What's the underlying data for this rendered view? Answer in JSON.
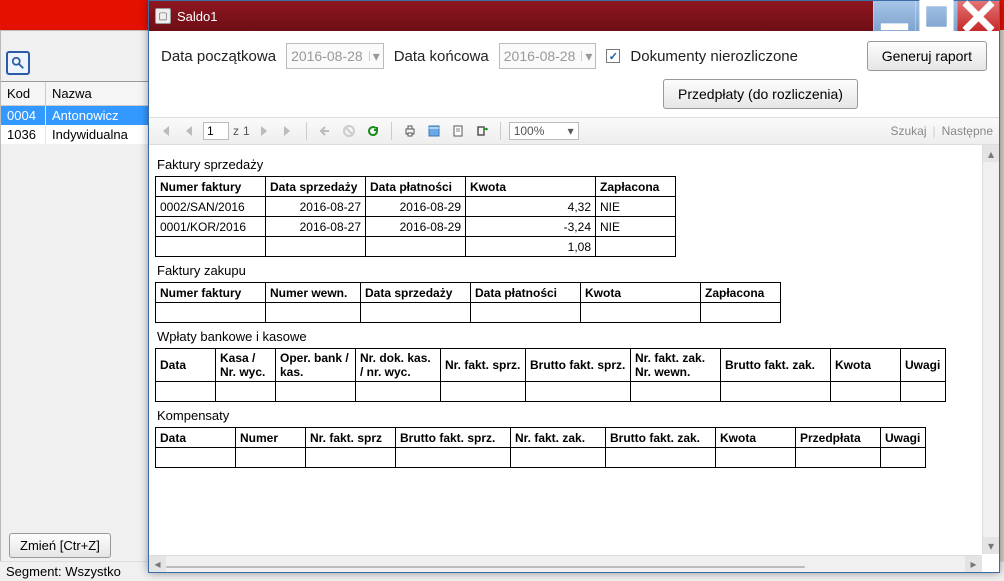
{
  "window": {
    "title": "Saldo1"
  },
  "params": {
    "start_label": "Data początkowa",
    "end_label": "Data końcowa",
    "start_value": "2016-08-28",
    "end_value": "2016-08-28",
    "unreconciled_label": "Dokumenty nierozliczone",
    "unreconciled_checked": "✓",
    "btn_report": "Generuj raport",
    "btn_prepay": "Przedpłaty (do rozliczenia)"
  },
  "viewer": {
    "page_current": "1",
    "page_of_prefix": "z",
    "page_total": "1",
    "zoom": "100%",
    "find_label": "Szukaj",
    "next_label": "Następne"
  },
  "left": {
    "col_kod": "Kod",
    "col_nazwa": "Nazwa",
    "rows": [
      {
        "kod": "0004",
        "nazwa": "Antonowicz"
      },
      {
        "kod": "1036",
        "nazwa": "Indywidualna"
      }
    ],
    "btn_change": "Zmień [Ctr+Z]",
    "status": "Segment: Wszystko"
  },
  "sections": {
    "sales": {
      "title": "Faktury sprzedaży",
      "cols": [
        "Numer faktury",
        "Data sprzedaży",
        "Data płatności",
        "Kwota",
        "Zapłacona"
      ],
      "rows": [
        {
          "num": "0002/SAN/2016",
          "sale": "2016-08-27",
          "due": "2016-08-29",
          "amount": "4,32",
          "paid": "NIE"
        },
        {
          "num": "0001/KOR/2016",
          "sale": "2016-08-27",
          "due": "2016-08-29",
          "amount": "-3,24",
          "paid": "NIE"
        }
      ],
      "sum_amount": "1,08"
    },
    "purchase": {
      "title": "Faktury zakupu",
      "cols": [
        "Numer faktury",
        "Numer wewn.",
        "Data sprzedaży",
        "Data płatności",
        "Kwota",
        "Zapłacona"
      ]
    },
    "payments": {
      "title": "Wpłaty bankowe i kasowe",
      "cols": [
        "Data",
        "Kasa / Nr. wyc.",
        "Oper. bank / kas.",
        "Nr. dok. kas. / nr. wyc.",
        "Nr. fakt. sprz.",
        "Brutto fakt. sprz.",
        "Nr. fakt. zak. Nr. wewn.",
        "Brutto fakt. zak.",
        "Kwota",
        "Uwagi"
      ]
    },
    "offsets": {
      "title": "Kompensaty",
      "cols": [
        "Data",
        "Numer",
        "Nr. fakt. sprz",
        "Brutto fakt. sprz.",
        "Nr. fakt. zak.",
        "Brutto fakt. zak.",
        "Kwota",
        "Przedpłata",
        "Uwagi"
      ]
    }
  }
}
